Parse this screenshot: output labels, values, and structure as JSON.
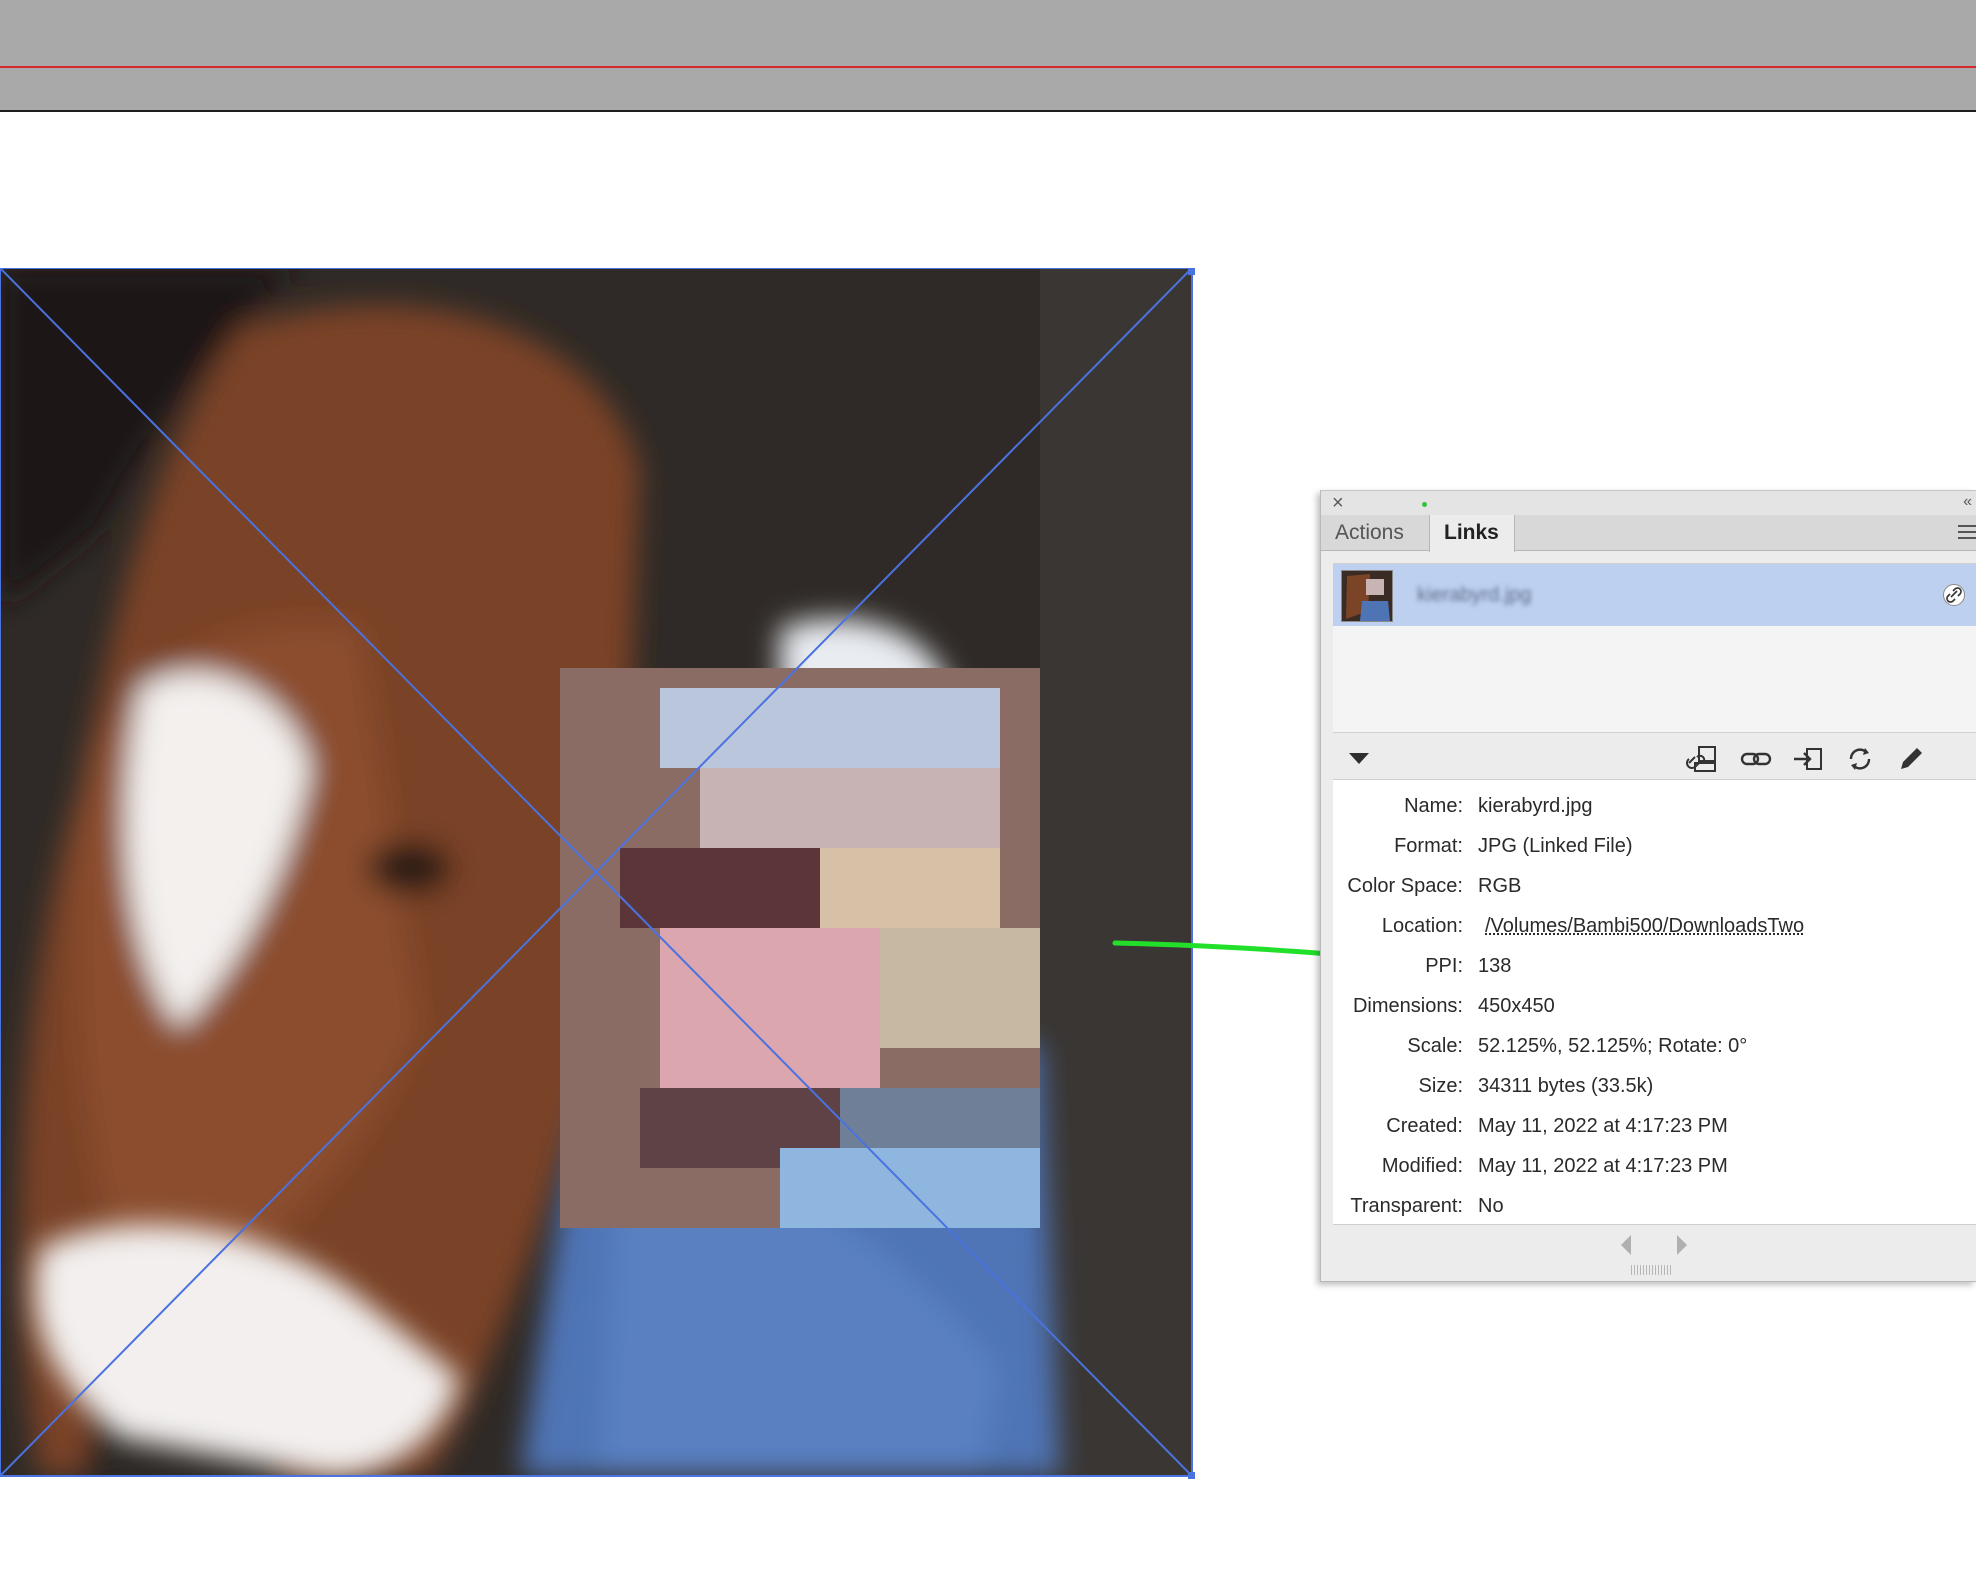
{
  "panel": {
    "tabs": [
      {
        "label": "Actions",
        "active": false
      },
      {
        "label": "Links",
        "active": true
      }
    ],
    "link_item": {
      "name": "kierabyrd.jpg"
    },
    "info": {
      "name_label": "Name:",
      "name_value": "kierabyrd.jpg",
      "format_label": "Format:",
      "format_value": "JPG (Linked File)",
      "colorspace_label": "Color Space:",
      "colorspace_value": "RGB",
      "location_label": "Location:",
      "location_value": "/Volumes/Bambi500/DownloadsTwo",
      "ppi_label": "PPI:",
      "ppi_value": "138",
      "dimensions_label": "Dimensions:",
      "dimensions_value": "450x450",
      "scale_label": "Scale:",
      "scale_value": "52.125%, 52.125%; Rotate: 0°",
      "size_label": "Size:",
      "size_value": "34311 bytes (33.5k)",
      "created_label": "Created:",
      "created_value": "May 11, 2022 at 4:17:23 PM",
      "modified_label": "Modified:",
      "modified_value": "May 11, 2022 at 4:17:23 PM",
      "transparent_label": "Transparent:",
      "transparent_value": "No"
    }
  },
  "icons": {
    "close": "close-icon",
    "collapse": "double-chevron-left-icon",
    "panel_menu": "hamburger-menu-icon",
    "disclosure": "triangle-down-icon",
    "relink_cc": "relink-cc-library-icon",
    "relink": "chain-link-icon",
    "goto_link": "go-to-link-icon",
    "update": "update-link-icon",
    "edit_original": "pencil-icon",
    "prev": "arrow-left-icon",
    "next": "arrow-right-icon"
  },
  "colors": {
    "frame_selection": "#4a72e0",
    "annotation": "#22e02a",
    "margin_guide": "#d52a2a",
    "selected_row": "#bdd0ef"
  }
}
